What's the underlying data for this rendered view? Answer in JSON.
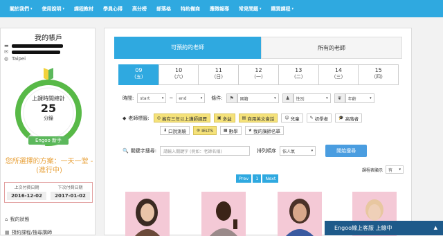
{
  "nav": {
    "items": [
      {
        "label": "關於我們",
        "caret": true
      },
      {
        "label": "使用說明",
        "caret": true
      },
      {
        "label": "課程教材",
        "caret": false
      },
      {
        "label": "學員心得",
        "caret": false
      },
      {
        "label": "高分榜",
        "caret": false
      },
      {
        "label": "部落格",
        "caret": false
      },
      {
        "label": "特約備商",
        "caret": false
      },
      {
        "label": "應徵報導",
        "caret": false
      },
      {
        "label": "常見問題",
        "caret": true
      },
      {
        "label": "購買課程",
        "caret": true
      }
    ]
  },
  "sidebar": {
    "title": "我的帳戶",
    "location": "Taipei",
    "gauge": {
      "label": "上課時間總計",
      "value": "25",
      "unit": "分鐘",
      "ribbon": "Engoo 新手",
      "ring_color": "#58b947"
    },
    "plan": "您所選擇的方案：一天一堂 - (進行中)",
    "last_payment_label": "上次付費日期",
    "last_payment": "2016-12-02",
    "next_payment_label": "下次付費日期",
    "next_payment": "2017-01-02",
    "links": [
      "我的狀態",
      "預約課程/搜尋講師"
    ]
  },
  "main": {
    "tab_bookable": "可預約的老師",
    "tab_all": "所有的老師",
    "days": [
      {
        "n": "09",
        "w": "(五)",
        "selected": true
      },
      {
        "n": "10",
        "w": "(六)",
        "selected": false
      },
      {
        "n": "11",
        "w": "(日)",
        "selected": false
      },
      {
        "n": "12",
        "w": "(一)",
        "selected": false
      },
      {
        "n": "13",
        "w": "(二)",
        "selected": false
      },
      {
        "n": "14",
        "w": "(三)",
        "selected": false
      },
      {
        "n": "15",
        "w": "(四)",
        "selected": false
      }
    ],
    "filters": {
      "time_label": "時間:",
      "start": "start",
      "tilde": "~",
      "end": "end",
      "cond_label": "條件:",
      "country": "國籍",
      "gender": "性別",
      "age": "年齡"
    },
    "tags_label": "老師標籤:",
    "tags_row1": [
      {
        "text": "擁有三年以上講師經歷",
        "y": true,
        "icon": "◎"
      },
      {
        "text": "多益",
        "y": true,
        "icon": "▣"
      },
      {
        "text": "商用英文會話",
        "y": true,
        "icon": "▤"
      },
      {
        "text": "兒童",
        "y": false,
        "icon": "☺"
      },
      {
        "text": "初學者",
        "y": false,
        "icon": "✎"
      },
      {
        "text": "高階者",
        "y": false,
        "icon": "🎓"
      }
    ],
    "tags_row2": [
      {
        "text": "口說測驗",
        "y": false,
        "icon": "⬇"
      },
      {
        "text": "IELTS",
        "y": true,
        "icon": "⊛"
      },
      {
        "text": "數學",
        "y": false,
        "icon": "▦"
      },
      {
        "text": "我的講師名單",
        "y": false,
        "icon": "★"
      }
    ],
    "keyword_label": "關鍵字搜尋:",
    "keyword_placeholder": "請輸入關鍵字 (例如：老師名稱)",
    "sort_label": "排列順序",
    "sort_value": "依人氣",
    "search_button": "開始搜尋",
    "per_page_label": "課程表顯示",
    "per_page_value": "有",
    "pager": {
      "prev": "Prev",
      "page": "1",
      "next": "Next"
    }
  },
  "chat": {
    "label": "Engoo線上客服 上線中",
    "toggle": "▲"
  }
}
